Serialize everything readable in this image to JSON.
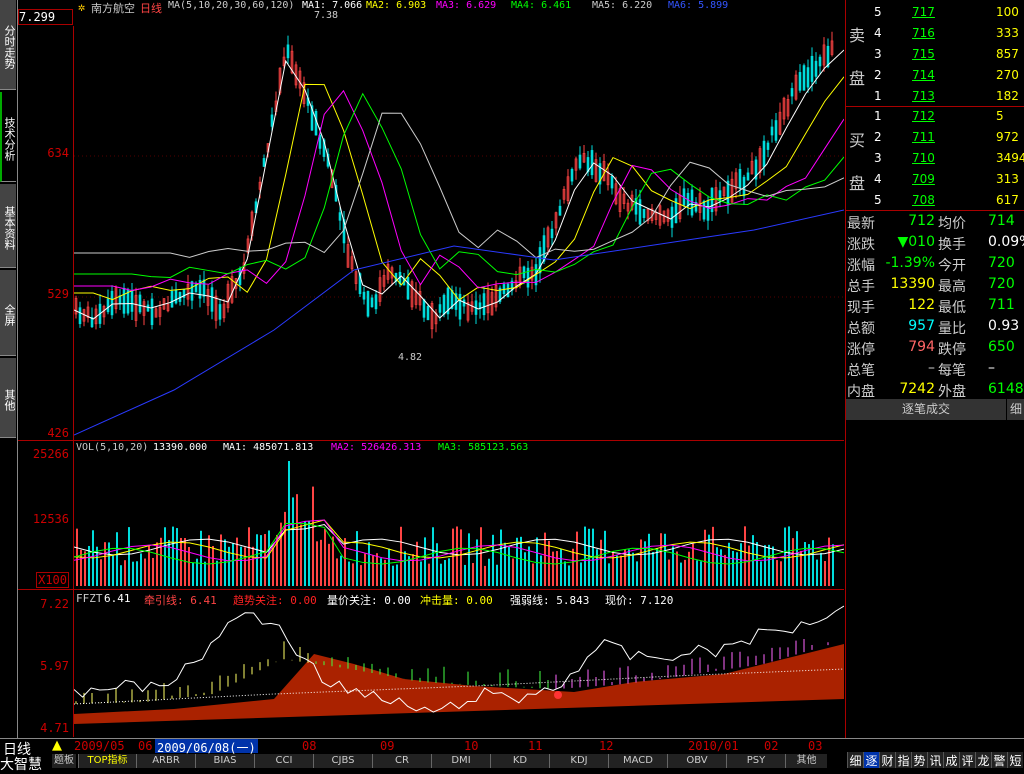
{
  "left_tabs": [
    "分时走势",
    "技术分析",
    "基本资料",
    "全屏",
    "其他"
  ],
  "header": {
    "price_box": "7.299",
    "stock_name": "南方航空",
    "period": "日线",
    "ma_params": "MA(5,10,20,30,60,120)",
    "ma1": "MA1: 7.066",
    "ma2": "MA2: 6.903",
    "ma3": "MA3: 6.629",
    "ma4": "MA4: 6.461",
    "ma5": "MA5: 6.220",
    "ma6": "MA6: 5.899"
  },
  "price_axis": [
    "634",
    "529",
    "426"
  ],
  "price_annot": {
    "high": "7.38",
    "low": "4.82"
  },
  "vol": {
    "label": "VOL(5,10,20)",
    "value": "13390.000",
    "ma1": "MA1: 485071.813",
    "ma2": "MA2: 526426.313",
    "ma3": "MA3: 585123.563",
    "axis": [
      "25266",
      "12536"
    ],
    "unit": "X100"
  },
  "ffzt": {
    "label": "FFZT",
    "v1": "6.41",
    "qyx": "牵引线: 6.41",
    "qsgz": "趋势关注: 0.00",
    "ljgz": "量价关注: 0.00",
    "cjl": "冲击量: 0.00",
    "qrx": "强弱线: 5.843",
    "xj": "现价: 7.120",
    "axis": [
      "7.22",
      "5.97",
      "4.71"
    ]
  },
  "order_book": {
    "sell_label_1": "卖",
    "sell_label_2": "盘",
    "buy_label_1": "买",
    "buy_label_2": "盘",
    "sell": [
      {
        "lvl": "5",
        "price": "717",
        "vol": "100"
      },
      {
        "lvl": "4",
        "price": "716",
        "vol": "333"
      },
      {
        "lvl": "3",
        "price": "715",
        "vol": "857"
      },
      {
        "lvl": "2",
        "price": "714",
        "vol": "270"
      },
      {
        "lvl": "1",
        "price": "713",
        "vol": "182"
      }
    ],
    "buy": [
      {
        "lvl": "1",
        "price": "712",
        "vol": "5"
      },
      {
        "lvl": "2",
        "price": "711",
        "vol": "972"
      },
      {
        "lvl": "3",
        "price": "710",
        "vol": "3494"
      },
      {
        "lvl": "4",
        "price": "709",
        "vol": "313"
      },
      {
        "lvl": "5",
        "price": "708",
        "vol": "617"
      }
    ]
  },
  "quote": [
    {
      "l1": "最新",
      "v1": "712",
      "l2": "均价",
      "v2": "714"
    },
    {
      "l1": "涨跌",
      "v1": "▼010",
      "l2": "换手",
      "v2": "0.09%"
    },
    {
      "l1": "涨幅",
      "v1": "-1.39%",
      "l2": "今开",
      "v2": "720"
    },
    {
      "l1": "总手",
      "v1": "13390",
      "l2": "最高",
      "v2": "720"
    },
    {
      "l1": "现手",
      "v1": "122",
      "l2": "最低",
      "v2": "711"
    },
    {
      "l1": "总额",
      "v1": "957",
      "l2": "量比",
      "v2": "0.93"
    },
    {
      "l1": "涨停",
      "v1": "794",
      "l2": "跌停",
      "v2": "650"
    },
    {
      "l1": "总笔",
      "v1": "–",
      "l2": "每笔",
      "v2": "–"
    },
    {
      "l1": "内盘",
      "v1": "7242",
      "l2": "外盘",
      "v2": "6148"
    }
  ],
  "trade_tab": "逐笔成交",
  "trade_tab2": "细",
  "bottom": {
    "mode": "日线",
    "app_name": "大智慧",
    "board": "题板",
    "cursor_date": "2009/06/08(一)",
    "dates": [
      "2009/05",
      "06",
      "08",
      "09",
      "10",
      "11",
      "12",
      "2010/01",
      "02",
      "03"
    ],
    "tabs": [
      "TOP指标",
      "ARBR",
      "BIAS",
      "CCI",
      "CJBS",
      "CR",
      "DMI",
      "KD",
      "KDJ",
      "MACD",
      "OBV",
      "PSY",
      "其他"
    ],
    "right_tabs": [
      "细",
      "逐",
      "财",
      "指",
      "势",
      "讯",
      "成",
      "评",
      "龙",
      "警",
      "短"
    ]
  },
  "colors": {
    "up": "#ff4444",
    "down": "#00dddd",
    "axis": "#aa0000",
    "ma1": "#ffffff",
    "ma2": "#ffff00",
    "ma3": "#ff00ff",
    "ma4": "#00ff00",
    "ma5": "#cccccc",
    "ma6": "#2a3aff"
  }
}
